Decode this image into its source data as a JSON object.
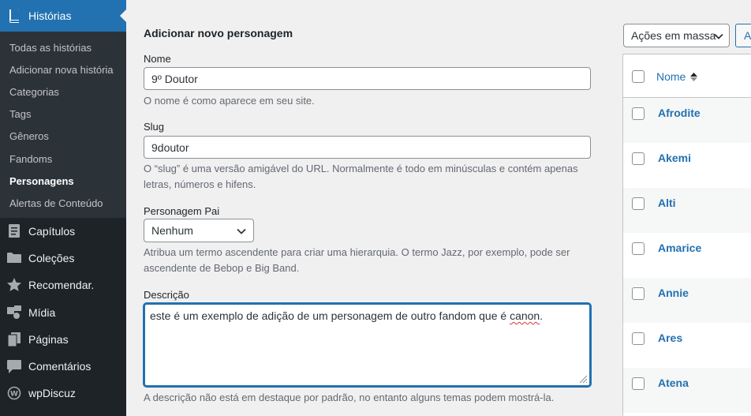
{
  "sidebar": {
    "active": {
      "label": "Histórias",
      "icon": "book-icon"
    },
    "submenu": [
      {
        "label": "Todas as histórias",
        "current": false
      },
      {
        "label": "Adicionar nova história",
        "current": false
      },
      {
        "label": "Categorias",
        "current": false
      },
      {
        "label": "Tags",
        "current": false
      },
      {
        "label": "Gêneros",
        "current": false
      },
      {
        "label": "Fandoms",
        "current": false
      },
      {
        "label": "Personagens",
        "current": true
      },
      {
        "label": "Alertas de Conteúdo",
        "current": false
      }
    ],
    "items": [
      {
        "label": "Capítulos",
        "icon": "document-icon"
      },
      {
        "label": "Coleções",
        "icon": "folder-icon"
      },
      {
        "label": "Recomendar.",
        "icon": "star-icon"
      },
      {
        "label": "Mídia",
        "icon": "media-icon"
      },
      {
        "label": "Páginas",
        "icon": "pages-icon"
      },
      {
        "label": "Comentários",
        "icon": "comment-icon"
      },
      {
        "label": "wpDiscuz",
        "icon": "wpdiscuz-icon"
      }
    ]
  },
  "form": {
    "title": "Adicionar novo personagem",
    "name": {
      "label": "Nome",
      "value": "9º Doutor",
      "help": "O nome é como aparece em seu site."
    },
    "slug": {
      "label": "Slug",
      "value": "9doutor",
      "help": "O “slug” é uma versão amigável do URL. Normalmente é todo em minúsculas e contém apenas letras, números e hifens."
    },
    "parent": {
      "label": "Personagem Pai",
      "value": "Nenhum",
      "help": "Atribua um termo ascendente para criar uma hierarquia. O termo Jazz, por exemplo, pode ser ascendente de Bebop e Big Band."
    },
    "description": {
      "label": "Descrição",
      "value_pre": "este é um exemplo de adição de um personagem de outro fandom que é ",
      "value_flagged": "canon",
      "value_post": ".",
      "help": "A descrição não está em destaque por padrão, no entanto alguns temas podem mostrá-la."
    }
  },
  "list": {
    "bulk_action": "Ações em massa",
    "apply_label": "A",
    "column_name": "Nome",
    "rows": [
      "Afrodite",
      "Akemi",
      "Alti",
      "Amarice",
      "Annie",
      "Ares",
      "Atena"
    ]
  },
  "colors": {
    "accent": "#2271b1",
    "sidebar_bg": "#1d2327",
    "submenu_bg": "#2c3338"
  }
}
